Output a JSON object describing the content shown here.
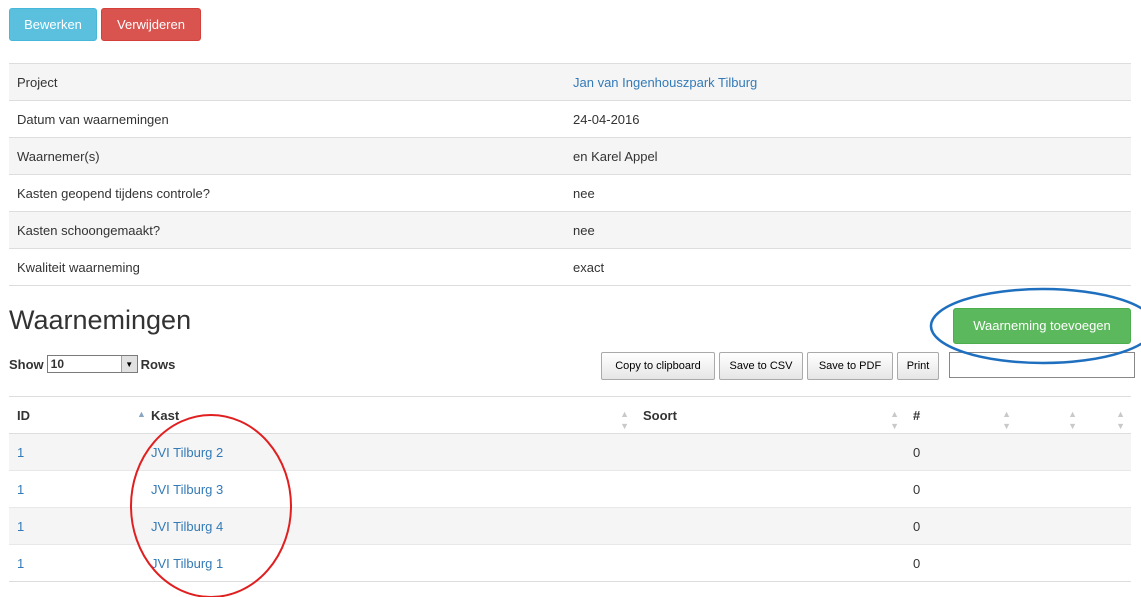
{
  "actions": {
    "edit_label": "Bewerken",
    "delete_label": "Verwijderen"
  },
  "details": [
    {
      "label": "Project",
      "value": "Jan van Ingenhouszpark Tilburg",
      "is_link": true
    },
    {
      "label": "Datum van waarnemingen",
      "value": "24-04-2016"
    },
    {
      "label": "Waarnemer(s)",
      "value": "en Karel Appel"
    },
    {
      "label": "Kasten geopend tijdens controle?",
      "value": "nee"
    },
    {
      "label": "Kasten schoongemaakt?",
      "value": "nee"
    },
    {
      "label": "Kwaliteit waarneming",
      "value": "exact"
    }
  ],
  "section": {
    "title": "Waarnemingen",
    "add_label": "Waarneming toevoegen"
  },
  "length_control": {
    "show_label": "Show",
    "selected": "10",
    "rows_label": "Rows"
  },
  "tools": {
    "copy": "Copy to clipboard",
    "csv": "Save to CSV",
    "pdf": "Save to PDF",
    "print": "Print"
  },
  "search": {
    "value": ""
  },
  "table": {
    "headers": [
      "ID",
      "Kast",
      "Soort",
      "#"
    ],
    "rows": [
      {
        "id": "1",
        "kast": "JVI Tilburg 2",
        "soort": "",
        "count": "0"
      },
      {
        "id": "1",
        "kast": "JVI Tilburg 3",
        "soort": "",
        "count": "0"
      },
      {
        "id": "1",
        "kast": "JVI Tilburg 4",
        "soort": "",
        "count": "0"
      },
      {
        "id": "1",
        "kast": "JVI Tilburg 1",
        "soort": "",
        "count": "0"
      }
    ]
  },
  "colors": {
    "edit_button": "#5bc0de",
    "delete_button": "#d9534f",
    "add_button": "#5cb85c",
    "link": "#337ab7",
    "annotation_circle_red": "#e02020",
    "annotation_ellipse_blue": "#1f6fbf"
  }
}
